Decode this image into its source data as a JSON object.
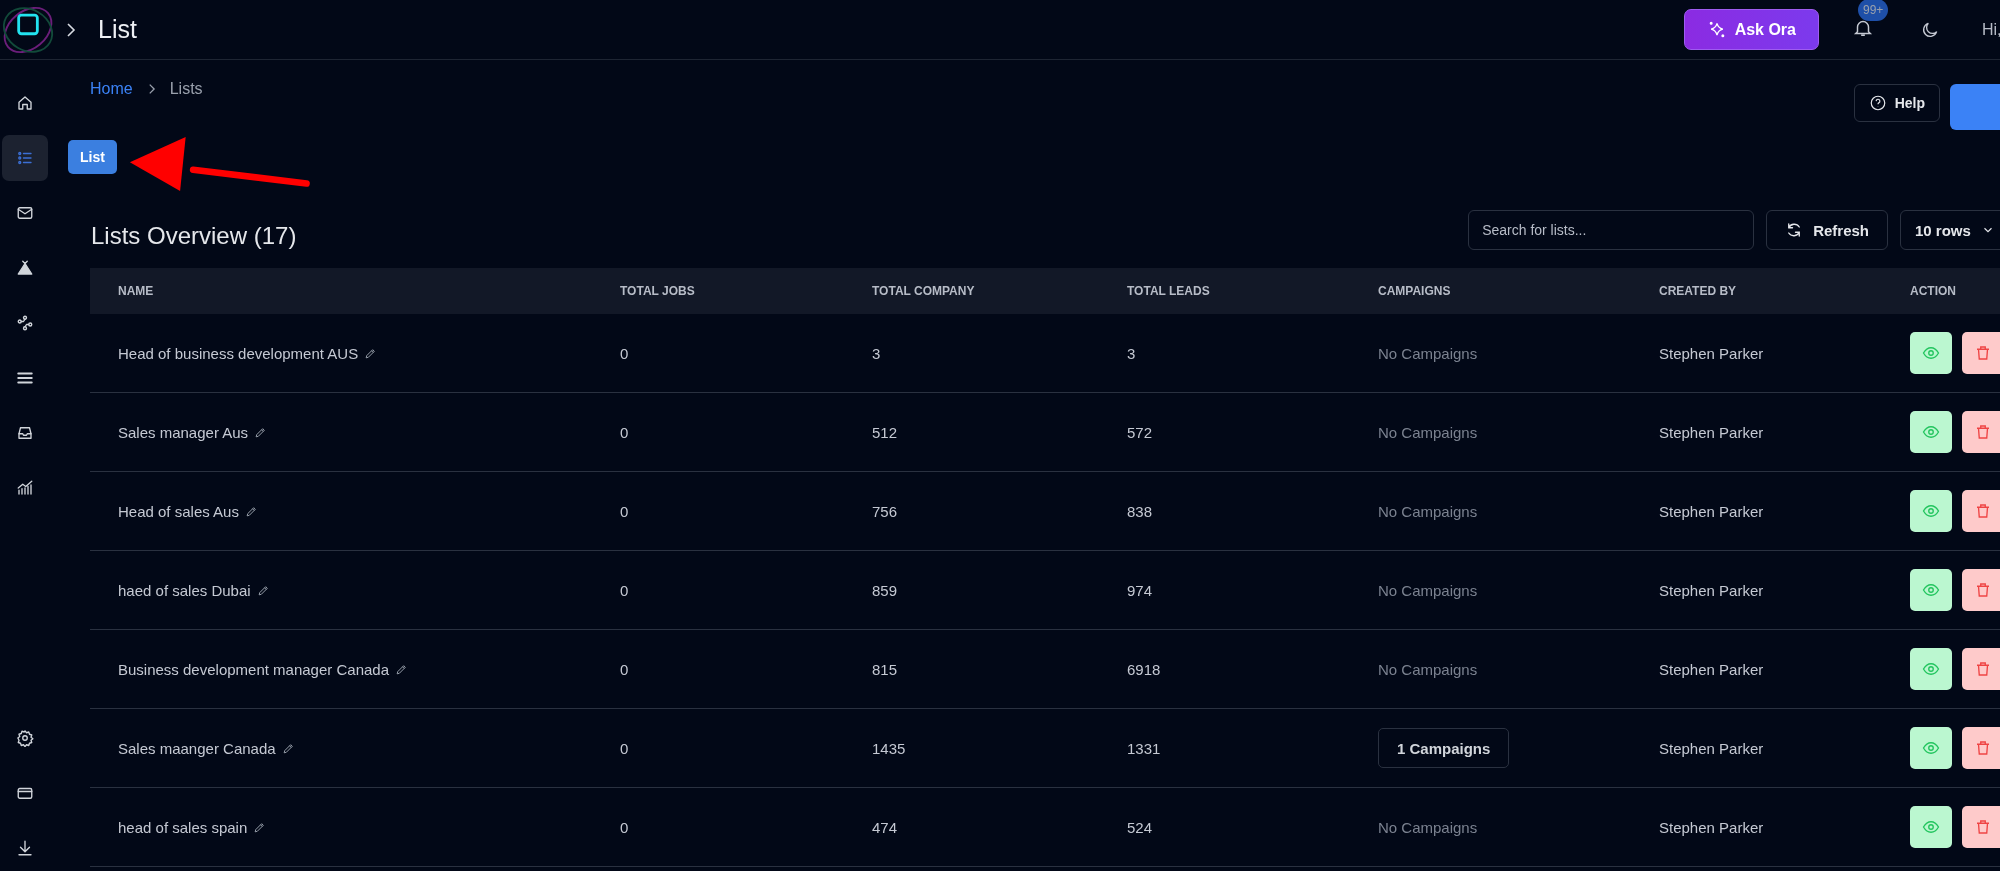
{
  "topbar": {
    "title": "List",
    "ask_button": "Ask Ora",
    "notification_badge": "99+",
    "greeting": "Hi,"
  },
  "sidebar": {
    "items": [
      {
        "selected": false
      },
      {
        "selected": true
      },
      {
        "selected": false
      },
      {
        "selected": false
      },
      {
        "selected": false
      },
      {
        "selected": false
      },
      {
        "selected": false
      },
      {
        "selected": false
      }
    ],
    "bottom_items": [
      {
        "selected": false
      },
      {
        "selected": false
      },
      {
        "selected": false
      }
    ]
  },
  "tooltip": "List",
  "breadcrumb": [
    {
      "label": "Home",
      "kind": "link"
    },
    {
      "label": "Lists",
      "kind": "current"
    }
  ],
  "help_button": "Help",
  "title": "Lists Overview (17)",
  "search": {
    "placeholder": "Search for lists..."
  },
  "refresh_button": "Refresh",
  "rows_select": "10 rows",
  "table": {
    "columns": [
      "NAME",
      "TOTAL JOBS",
      "TOTAL COMPANY",
      "TOTAL LEADS",
      "CAMPAIGNS",
      "CREATED BY",
      "ACTION"
    ],
    "rows": [
      {
        "name": "Head of business development AUS",
        "jobs": "0",
        "company": "3",
        "leads": "3",
        "campaigns": {
          "kind": "none",
          "label": "No Campaigns"
        },
        "created_by": "Stephen Parker"
      },
      {
        "name": "Sales manager Aus",
        "jobs": "0",
        "company": "512",
        "leads": "572",
        "campaigns": {
          "kind": "none",
          "label": "No Campaigns"
        },
        "created_by": "Stephen Parker"
      },
      {
        "name": "Head of sales Aus",
        "jobs": "0",
        "company": "756",
        "leads": "838",
        "campaigns": {
          "kind": "none",
          "label": "No Campaigns"
        },
        "created_by": "Stephen Parker"
      },
      {
        "name": "haed of sales Dubai",
        "jobs": "0",
        "company": "859",
        "leads": "974",
        "campaigns": {
          "kind": "none",
          "label": "No Campaigns"
        },
        "created_by": "Stephen Parker"
      },
      {
        "name": "Business development manager Canada",
        "jobs": "0",
        "company": "815",
        "leads": "6918",
        "campaigns": {
          "kind": "none",
          "label": "No Campaigns"
        },
        "created_by": "Stephen Parker"
      },
      {
        "name": "Sales maanger Canada",
        "jobs": "0",
        "company": "1435",
        "leads": "1331",
        "campaigns": {
          "kind": "button",
          "label": "1 Campaigns"
        },
        "created_by": "Stephen Parker"
      },
      {
        "name": "head of sales spain",
        "jobs": "0",
        "company": "474",
        "leads": "524",
        "campaigns": {
          "kind": "none",
          "label": "No Campaigns"
        },
        "created_by": "Stephen Parker"
      }
    ]
  }
}
